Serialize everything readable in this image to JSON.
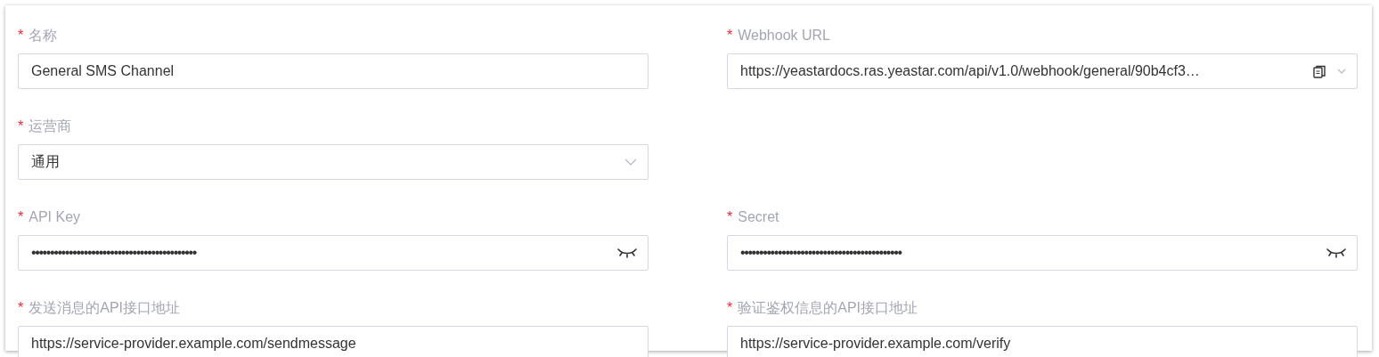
{
  "rows": [
    {
      "fields": [
        {
          "required_mark": "*",
          "label": "名称",
          "kind": "text",
          "value": "General SMS Channel"
        },
        {
          "required_mark": "*",
          "label": "Webhook URL",
          "kind": "copyable",
          "value": "https://yeastardocs.ras.yeastar.com/api/v1.0/webhook/general/90b4cf3…"
        }
      ]
    },
    {
      "fields": [
        {
          "required_mark": "*",
          "label": "运营商",
          "kind": "select",
          "value": "通用"
        }
      ]
    },
    {
      "fields": [
        {
          "required_mark": "*",
          "label": "API Key",
          "kind": "password",
          "value": "••••••••••••••••••••••••••••••••••••••••••••"
        },
        {
          "required_mark": "*",
          "label": "Secret",
          "kind": "password",
          "value": "•••••••••••••••••••••••••••••••••••••••••••"
        }
      ]
    },
    {
      "fields": [
        {
          "required_mark": "*",
          "label": "发送消息的API接口地址",
          "kind": "text",
          "value": "https://service-provider.example.com/sendmessage"
        },
        {
          "required_mark": "*",
          "label": "验证鉴权信息的API接口地址",
          "kind": "text",
          "value": "https://service-provider.example.com/verify"
        }
      ]
    }
  ]
}
